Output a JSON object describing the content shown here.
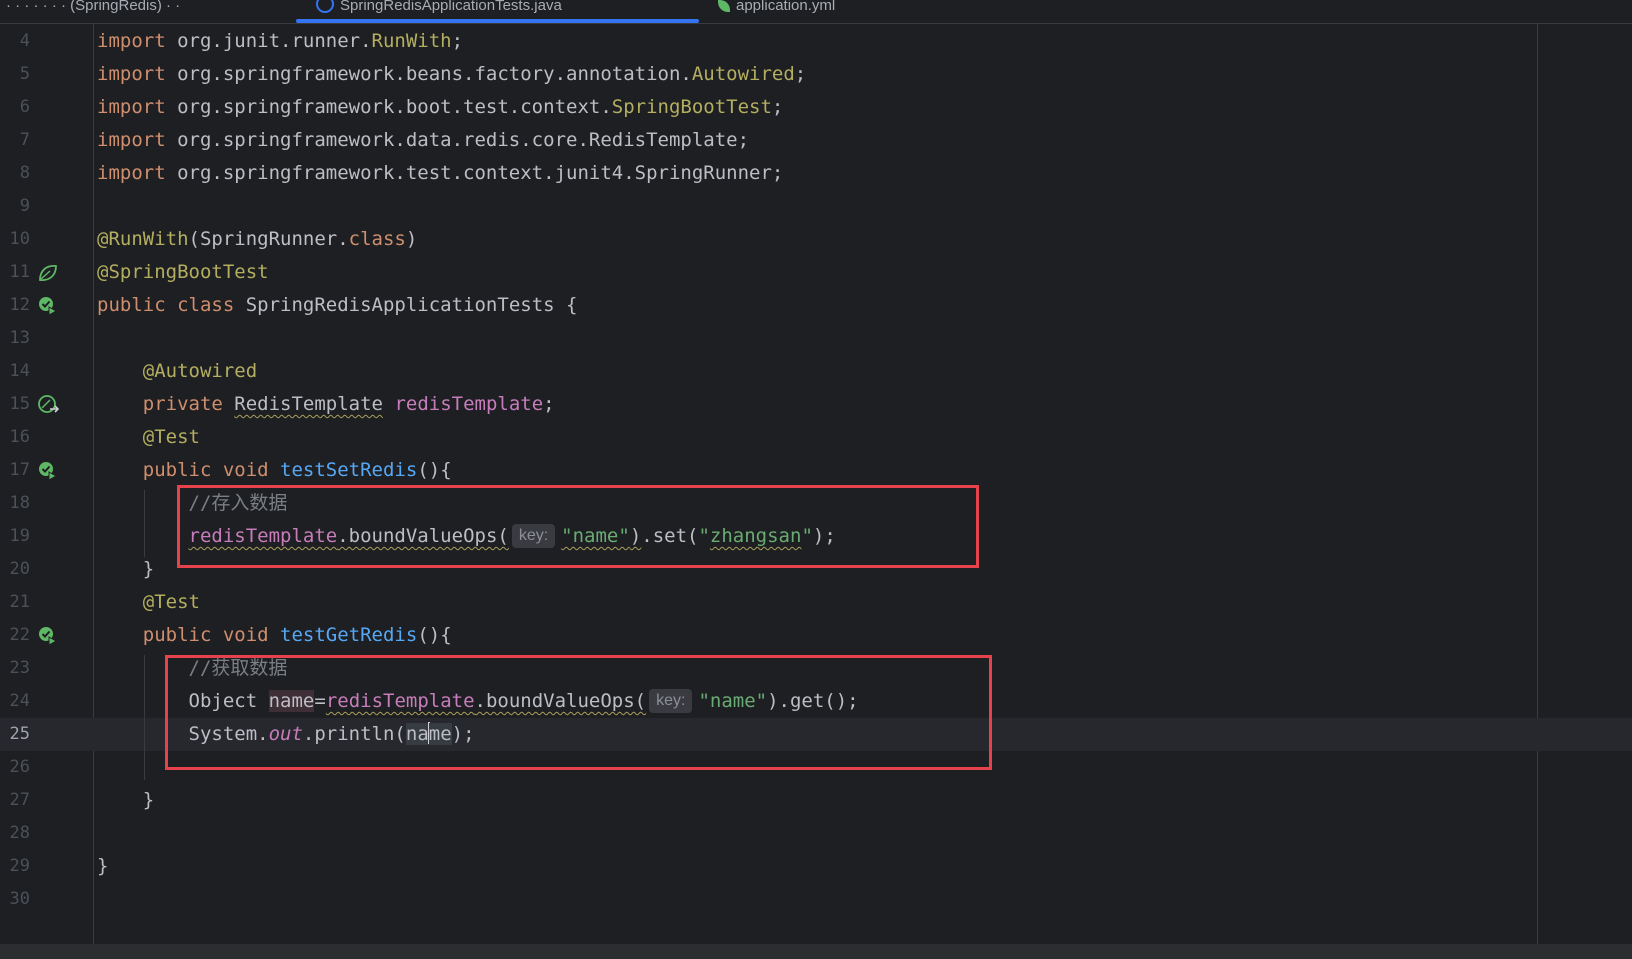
{
  "tabs": [
    {
      "label": "· · · · · · · (SpringRedis) · ·"
    },
    {
      "label": "SpringRedisApplicationTests.java"
    },
    {
      "label": "application.yml"
    }
  ],
  "lines": [
    {
      "n": "4",
      "parts": [
        [
          "kw",
          "import "
        ],
        [
          "",
          "org.junit.runner."
        ],
        [
          "cls",
          "RunWith"
        ],
        [
          "",
          ";"
        ]
      ]
    },
    {
      "n": "5",
      "parts": [
        [
          "kw",
          "import "
        ],
        [
          "",
          "org.springframework.beans.factory.annotation."
        ],
        [
          "cls",
          "Autowired"
        ],
        [
          "",
          ";"
        ]
      ]
    },
    {
      "n": "6",
      "parts": [
        [
          "kw",
          "import "
        ],
        [
          "",
          "org.springframework.boot.test.context."
        ],
        [
          "cls",
          "SpringBootTest"
        ],
        [
          "",
          ";"
        ]
      ]
    },
    {
      "n": "7",
      "parts": [
        [
          "kw",
          "import "
        ],
        [
          "",
          "org.springframework.data.redis.core.RedisTemplate;"
        ]
      ]
    },
    {
      "n": "8",
      "parts": [
        [
          "kw",
          "import "
        ],
        [
          "",
          "org.springframework.test.context.junit4.SpringRunner;"
        ]
      ]
    },
    {
      "n": "9",
      "parts": []
    },
    {
      "n": "10",
      "parts": [
        [
          "ann",
          "@RunWith"
        ],
        [
          "",
          "(SpringRunner."
        ],
        [
          "kw",
          "class"
        ],
        [
          "",
          ")"
        ]
      ]
    },
    {
      "n": "11",
      "icon": "spring-leaf",
      "parts": [
        [
          "ann",
          "@SpringBootTest"
        ]
      ]
    },
    {
      "n": "12",
      "icon": "run-test",
      "parts": [
        [
          "kw",
          "public class "
        ],
        [
          "",
          "SpringRedisApplicationTests {"
        ]
      ]
    },
    {
      "n": "13",
      "parts": []
    },
    {
      "n": "14",
      "parts": [
        [
          "",
          "    "
        ],
        [
          "ann",
          "@Autowired"
        ]
      ]
    },
    {
      "n": "15",
      "icon": "bean-navigate",
      "parts": [
        [
          "",
          "    "
        ],
        [
          "kw",
          "private "
        ],
        [
          "squig",
          "RedisTemplate"
        ],
        [
          "",
          " "
        ],
        [
          "fld",
          "redisTemplate"
        ],
        [
          "",
          ";"
        ]
      ]
    },
    {
      "n": "16",
      "parts": [
        [
          "",
          "    "
        ],
        [
          "ann",
          "@Test"
        ]
      ]
    },
    {
      "n": "17",
      "icon": "run-test",
      "parts": [
        [
          "",
          "    "
        ],
        [
          "kw",
          "public void "
        ],
        [
          "fn",
          "testSetRedis"
        ],
        [
          "",
          "(){"
        ]
      ]
    },
    {
      "n": "18",
      "parts": [
        [
          "",
          "        "
        ],
        [
          "cmt",
          "//存入数据"
        ]
      ]
    },
    {
      "n": "19",
      "parts": [
        [
          "",
          "        "
        ],
        [
          "fld squig",
          "redisTemplate"
        ],
        [
          "squig",
          ".boundValueOps("
        ],
        [
          "hint",
          "key:"
        ],
        [
          "str squig",
          "\"name\""
        ],
        [
          "squig",
          ")"
        ],
        [
          "",
          ".set("
        ],
        [
          "str",
          "\""
        ],
        [
          "str squig",
          "zhangsan"
        ],
        [
          "str",
          "\""
        ],
        [
          "",
          ");"
        ]
      ]
    },
    {
      "n": "20",
      "parts": [
        [
          "",
          "    }"
        ]
      ]
    },
    {
      "n": "21",
      "parts": [
        [
          "",
          "    "
        ],
        [
          "ann",
          "@Test"
        ]
      ]
    },
    {
      "n": "22",
      "icon": "run-test",
      "parts": [
        [
          "",
          "    "
        ],
        [
          "kw",
          "public void "
        ],
        [
          "fn",
          "testGetRedis"
        ],
        [
          "",
          "(){"
        ]
      ]
    },
    {
      "n": "23",
      "parts": [
        [
          "",
          "        "
        ],
        [
          "cmt",
          "//获取数据"
        ]
      ]
    },
    {
      "n": "24",
      "parts": [
        [
          "",
          "        Object "
        ],
        [
          "hl-var",
          "name"
        ],
        [
          "",
          "="
        ],
        [
          "fld squig",
          "redisTemplate"
        ],
        [
          "squig",
          ".boundValueOps("
        ],
        [
          "hint",
          "key:"
        ],
        [
          "str",
          "\"name\""
        ],
        [
          "",
          ").get();"
        ]
      ]
    },
    {
      "n": "25",
      "current": true,
      "parts": [
        [
          "",
          "        System."
        ],
        [
          "stat",
          "out"
        ],
        [
          "",
          ".println("
        ],
        [
          "hl-read",
          "na"
        ],
        [
          "caret",
          ""
        ],
        [
          "hl-read",
          "me"
        ],
        [
          "",
          ");"
        ]
      ]
    },
    {
      "n": "26",
      "parts": []
    },
    {
      "n": "27",
      "parts": [
        [
          "",
          "    }"
        ]
      ]
    },
    {
      "n": "28",
      "parts": []
    },
    {
      "n": "29",
      "parts": [
        [
          "",
          "}"
        ]
      ]
    },
    {
      "n": "30",
      "parts": []
    }
  ],
  "colors": {
    "accent": "#3574f0",
    "highlight_box": "#e5424b",
    "run_icon": "#5fb865"
  }
}
